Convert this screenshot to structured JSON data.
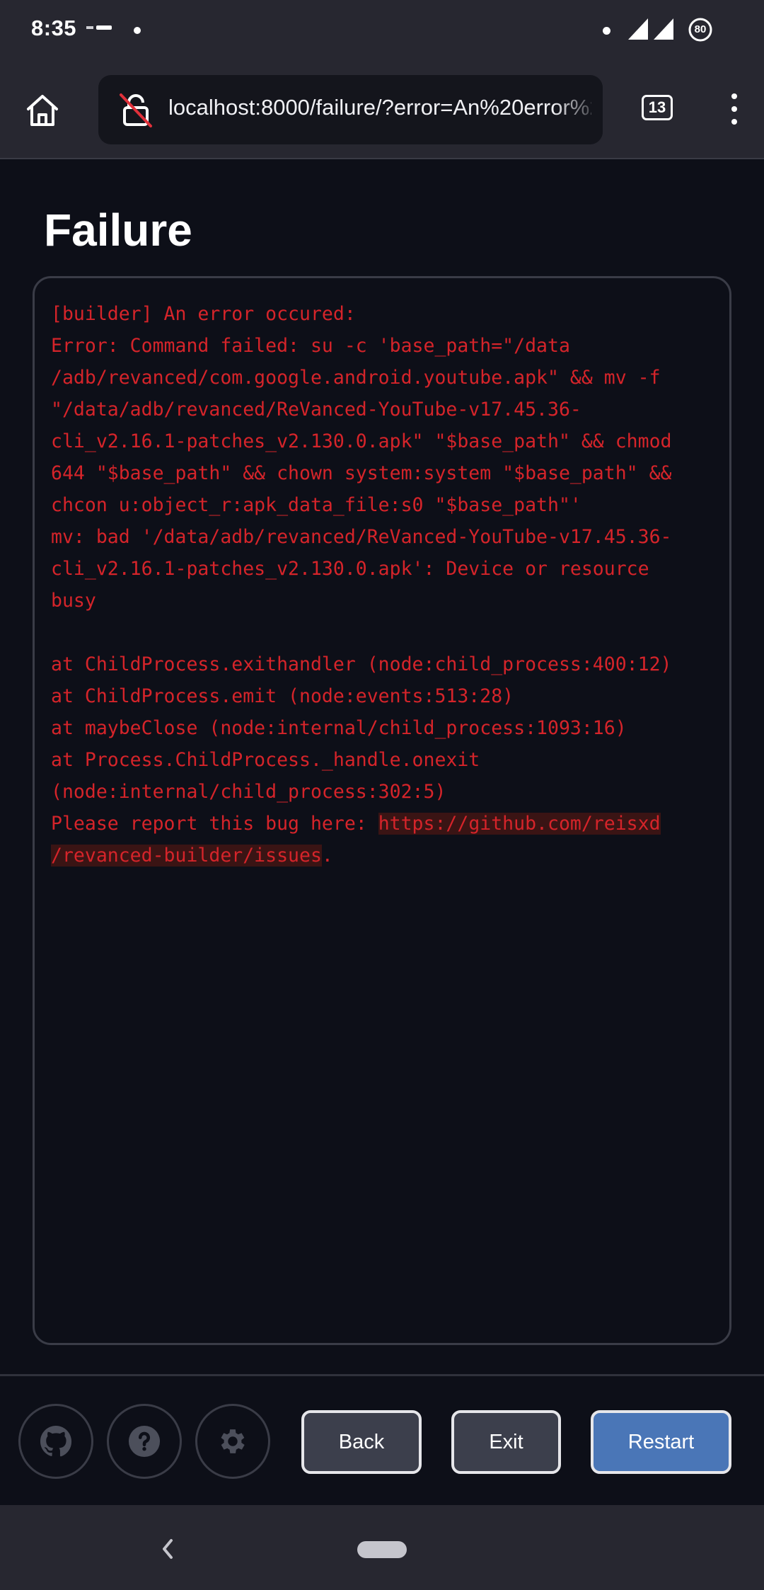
{
  "status_bar": {
    "time": "8:35",
    "battery_level": "80"
  },
  "browser": {
    "url": "localhost:8000/failure/?error=An%20error%2",
    "tab_count": "13"
  },
  "page": {
    "title": "Failure",
    "log_lines": [
      "[builder] An error occured:",
      "Error: Command failed: su -c 'base_path=\"/data",
      "/adb/revanced/com.google.android.youtube.apk\" && mv -f",
      "\"/data/adb/revanced/ReVanced-YouTube-v17.45.36-",
      "cli_v2.16.1-patches_v2.130.0.apk\" \"$base_path\" && chmod",
      "644 \"$base_path\" && chown system:system \"$base_path\" &&",
      "chcon u:object_r:apk_data_file:s0 \"$base_path\"'",
      "mv: bad '/data/adb/revanced/ReVanced-YouTube-v17.45.36-",
      "cli_v2.16.1-patches_v2.130.0.apk': Device or resource",
      "busy",
      "",
      "at ChildProcess.exithandler (node:child_process:400:12)",
      "at ChildProcess.emit (node:events:513:28)",
      "at maybeClose (node:internal/child_process:1093:16)",
      "at Process.ChildProcess._handle.onexit",
      "(node:internal/child_process:302:5)"
    ],
    "report_prefix": "Please report this bug here: ",
    "report_link_line1": "https://github.com/reisxd",
    "report_link_line2": "/revanced-builder/issues",
    "report_suffix": "."
  },
  "footer": {
    "icons": [
      "github-icon",
      "help-icon",
      "settings-icon"
    ],
    "back_label": "Back",
    "exit_label": "Exit",
    "restart_label": "Restart"
  },
  "colors": {
    "error_text": "#d5242a",
    "accent_button": "#4a76b7",
    "background": "#0d0f18"
  }
}
